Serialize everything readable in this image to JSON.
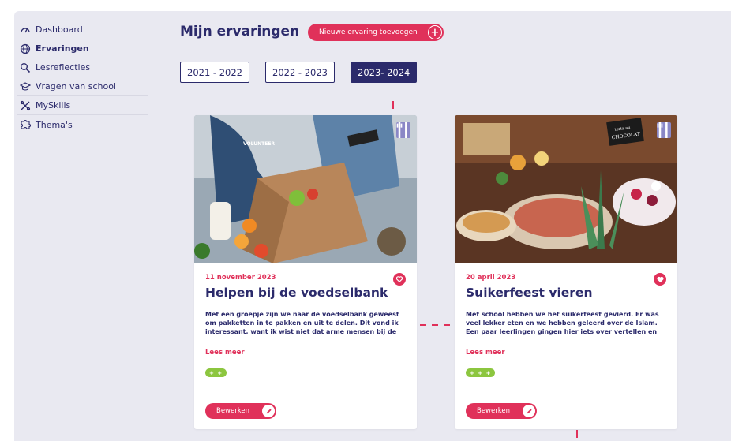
{
  "sidebar": {
    "items": [
      {
        "label": "Dashboard",
        "icon": "gauge-icon"
      },
      {
        "label": "Ervaringen",
        "icon": "globe-icon"
      },
      {
        "label": "Lesreflecties",
        "icon": "magnifier-icon"
      },
      {
        "label": "Vragen van school",
        "icon": "graduation-cap-icon"
      },
      {
        "label": "MySkills",
        "icon": "tools-icon"
      },
      {
        "label": "Thema's",
        "icon": "puzzle-icon"
      }
    ]
  },
  "header": {
    "title": "Mijn ervaringen",
    "add_button": "Nieuwe ervaring toevoegen",
    "add_symbol": "+"
  },
  "years": {
    "tabs": [
      "2021 - 2022",
      "2022 - 2023",
      "2023- 2024"
    ],
    "separator": "-",
    "active": "2023- 2024"
  },
  "cards": [
    {
      "date": "11 november 2023",
      "title": "Helpen bij de voedselbank",
      "description": "Met een groepje zijn we naar de voedselbank geweest om pakketten in te pakken en uit te delen. Dit vond ik interessant, want ik wist niet dat arme mensen bij de",
      "read_more": "Lees meer",
      "skill": "+ +",
      "edit": "Bewerken",
      "image_text": "VOLUNTEER"
    },
    {
      "date": "20 april 2023",
      "title": "Suikerfeest vieren",
      "description": "Met school hebben we het suikerfeest gevierd. Er was veel lekker eten en we hebben geleerd over de Islam. Een paar leerlingen gingen hier iets over vertellen en",
      "read_more": "Lees meer",
      "skill": "+ + +",
      "edit": "Bewerken",
      "image_text_1": "torta au",
      "image_text_2": "CHOCOLAT"
    }
  ],
  "colors": {
    "accent": "#e0315a",
    "navy": "#2b2a6b",
    "background": "#e9e9f1",
    "skill_green": "#8cc63f",
    "badge": "#8a87c6"
  }
}
